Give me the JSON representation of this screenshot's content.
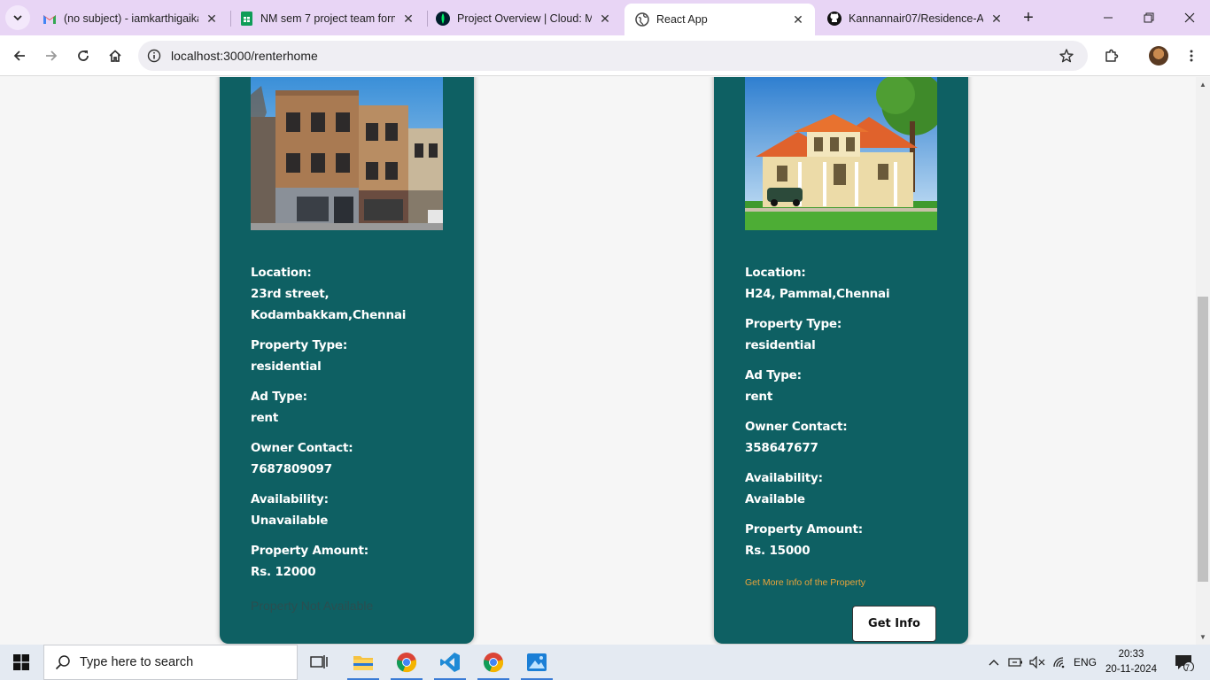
{
  "browser": {
    "tabs": [
      {
        "title": "(no subject) - iamkarthigaika",
        "icon": "gmail-icon"
      },
      {
        "title": "NM sem 7 project team form",
        "icon": "sheets-icon"
      },
      {
        "title": "Project Overview | Cloud: Mo",
        "icon": "mongodb-icon"
      },
      {
        "title": "React App",
        "icon": "globe-icon",
        "active": true
      },
      {
        "title": "Kannannair07/Residence-Au",
        "icon": "github-icon"
      }
    ],
    "url": "localhost:3000/renterhome"
  },
  "properties": [
    {
      "image": "brick-apartment-photo",
      "location_label": "Location:",
      "location_line1": "23rd street,",
      "location_line2": "Kodambakkam,Chennai",
      "property_type_label": "Property Type:",
      "property_type": "residential",
      "ad_type_label": "Ad Type:",
      "ad_type": "rent",
      "owner_contact_label": "Owner Contact:",
      "owner_contact": "7687809097",
      "availability_label": "Availability:",
      "availability": "Unavailable",
      "amount_label": "Property Amount:",
      "amount": "Rs. 12000",
      "status_text": "Property Not Available"
    },
    {
      "image": "villa-house-photo",
      "location_label": "Location:",
      "location_line1": "H24, Pammal,Chennai",
      "property_type_label": "Property Type:",
      "property_type": "residential",
      "ad_type_label": "Ad Type:",
      "ad_type": "rent",
      "owner_contact_label": "Owner Contact:",
      "owner_contact": "358647677",
      "availability_label": "Availability:",
      "availability": "Available",
      "amount_label": "Property Amount:",
      "amount": "Rs. 15000",
      "more_info_text": "Get More Info of the Property",
      "button_label": "Get Info"
    }
  ],
  "taskbar": {
    "search_placeholder": "Type here to search",
    "language": "ENG",
    "time": "20:33",
    "date": "20-11-2024",
    "notification_count": "7"
  },
  "colors": {
    "card_bg": "#0e6063",
    "tabstrip_bg": "#e8d5f5",
    "more_info": "#e8a33a"
  }
}
